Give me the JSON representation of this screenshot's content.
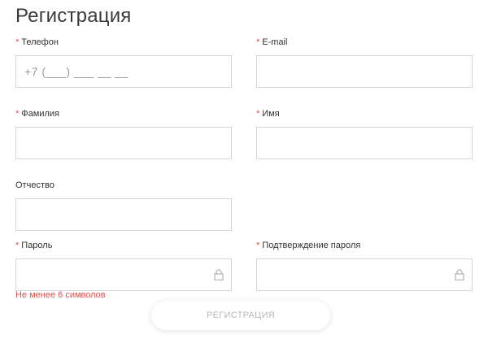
{
  "form": {
    "title": "Регистрация",
    "required_marker": "*",
    "phone": {
      "label": "Телефон",
      "placeholder": "+7 (___) ___ __ __"
    },
    "email": {
      "label": "E-mail"
    },
    "last_name": {
      "label": "Фамилия"
    },
    "first_name": {
      "label": "Имя"
    },
    "middle_name": {
      "label": "Отчество"
    },
    "password": {
      "label": "Пароль",
      "hint": "Не менее 6 символов",
      "icon": "lock-icon"
    },
    "password_confirm": {
      "label": "Подтверждение пароля",
      "icon": "lock-icon"
    },
    "submit_label": "РЕГИСТРАЦИЯ"
  },
  "colors": {
    "required": "#d9534f",
    "hint": "#d9534f",
    "border": "#d6d6d6",
    "submit_text": "#b8b8b8"
  }
}
